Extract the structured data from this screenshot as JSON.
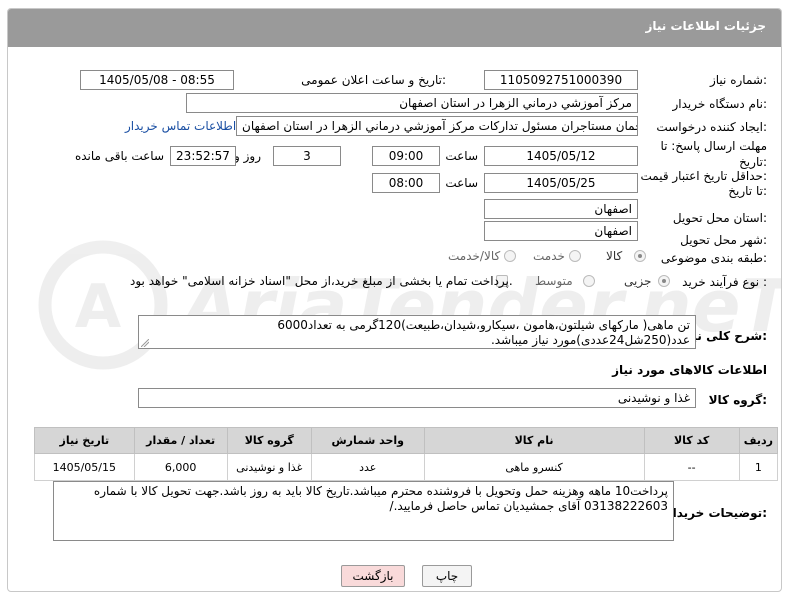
{
  "header": {
    "title": "جزئیات اطلاعات نیاز"
  },
  "need_number": {
    "label": "شماره نیاز:",
    "value": "1105092751000390"
  },
  "announce_datetime": {
    "label": "تاریخ و ساعت اعلان عمومی:",
    "value": "1405/05/08 - 08:55"
  },
  "buyer_org": {
    "label": "نام دستگاه خریدار:",
    "value": "مرکز آموزشي درماني الزهرا در استان اصفهان"
  },
  "requester": {
    "label": "ایجاد کننده درخواست:",
    "value": "رحمان مستاجران مسئول تدارکات مرکز آموزشي درماني الزهرا در استان اصفهان",
    "contact_link": "اطلاعات تماس خریدار"
  },
  "reply_deadline": {
    "label_line1": "مهلت ارسال پاسخ: تا",
    "label_line2": "تاریخ:",
    "date": "1405/05/12",
    "time_label": "ساعت",
    "time": "09:00",
    "days": "3",
    "days_label": "روز و",
    "remaining": "23:52:57",
    "remaining_label": "ساعت باقی مانده"
  },
  "price_validity": {
    "label_line1": "حداقل تاریخ اعتبار قیمت:",
    "label_line2": "تا تاریخ:",
    "date": "1405/05/25",
    "time_label": "ساعت",
    "time": "08:00"
  },
  "delivery_province": {
    "label": "استان محل تحویل:",
    "value": "اصفهان"
  },
  "delivery_city": {
    "label": "شهر محل تحویل:",
    "value": "اصفهان"
  },
  "category": {
    "label": "طبقه بندی موضوعی:",
    "options": [
      "کالا",
      "خدمت",
      "کالا/خدمت"
    ],
    "selected": "کالا"
  },
  "purchase_process": {
    "label": "نوع فرآیند خرید :",
    "options": [
      "جزیی",
      "متوسط"
    ],
    "selected": "جزیی",
    "treasury_note": "پرداخت تمام یا بخشی از مبلغ خرید،از محل \"اسناد خزانه اسلامی\" خواهد بود."
  },
  "description": {
    "label": "شرح کلی نیاز:",
    "text": "تن ماهی( مارکهای شیلتون،هامون ،سیکارو،شیدان،طبیعت)120گرمی به تعداد6000 عدد(250شل24عددی)مورد نیاز میباشد."
  },
  "goods_info_title": "اطلاعات کالاهای مورد نیاز",
  "goods_group": {
    "label": "گروه کالا:",
    "value": "غذا و نوشیدنی"
  },
  "items_table": {
    "headers": [
      "ردیف",
      "کد کالا",
      "نام کالا",
      "واحد شمارش",
      "گروه کالا",
      "تعداد / مقدار",
      "تاریخ نیاز"
    ],
    "rows": [
      [
        "1",
        "--",
        "کنسرو ماهی",
        "عدد",
        "غذا و نوشیدنی",
        "6,000",
        "1405/05/15"
      ]
    ]
  },
  "buyer_notes": {
    "label": "توضیحات خریدار:",
    "text": "پرداخت10 ماهه وهزینه حمل وتحویل با فروشنده محترم  میباشد.تاریخ کالا باید به روز باشد.جهت تحویل کالا با شماره 03138222603 آقای جمشیدیان تماس حاصل فرمایید./"
  },
  "buttons": {
    "print": "چاپ",
    "back": "بازگشت"
  },
  "watermark": {
    "text": "AriaTender.neT"
  },
  "colors": {
    "header_bg": "#9a9a9a",
    "link": "#1a4fa3",
    "back_button_bg": "#f9dada",
    "table_header_bg": "#d6d6d6"
  }
}
